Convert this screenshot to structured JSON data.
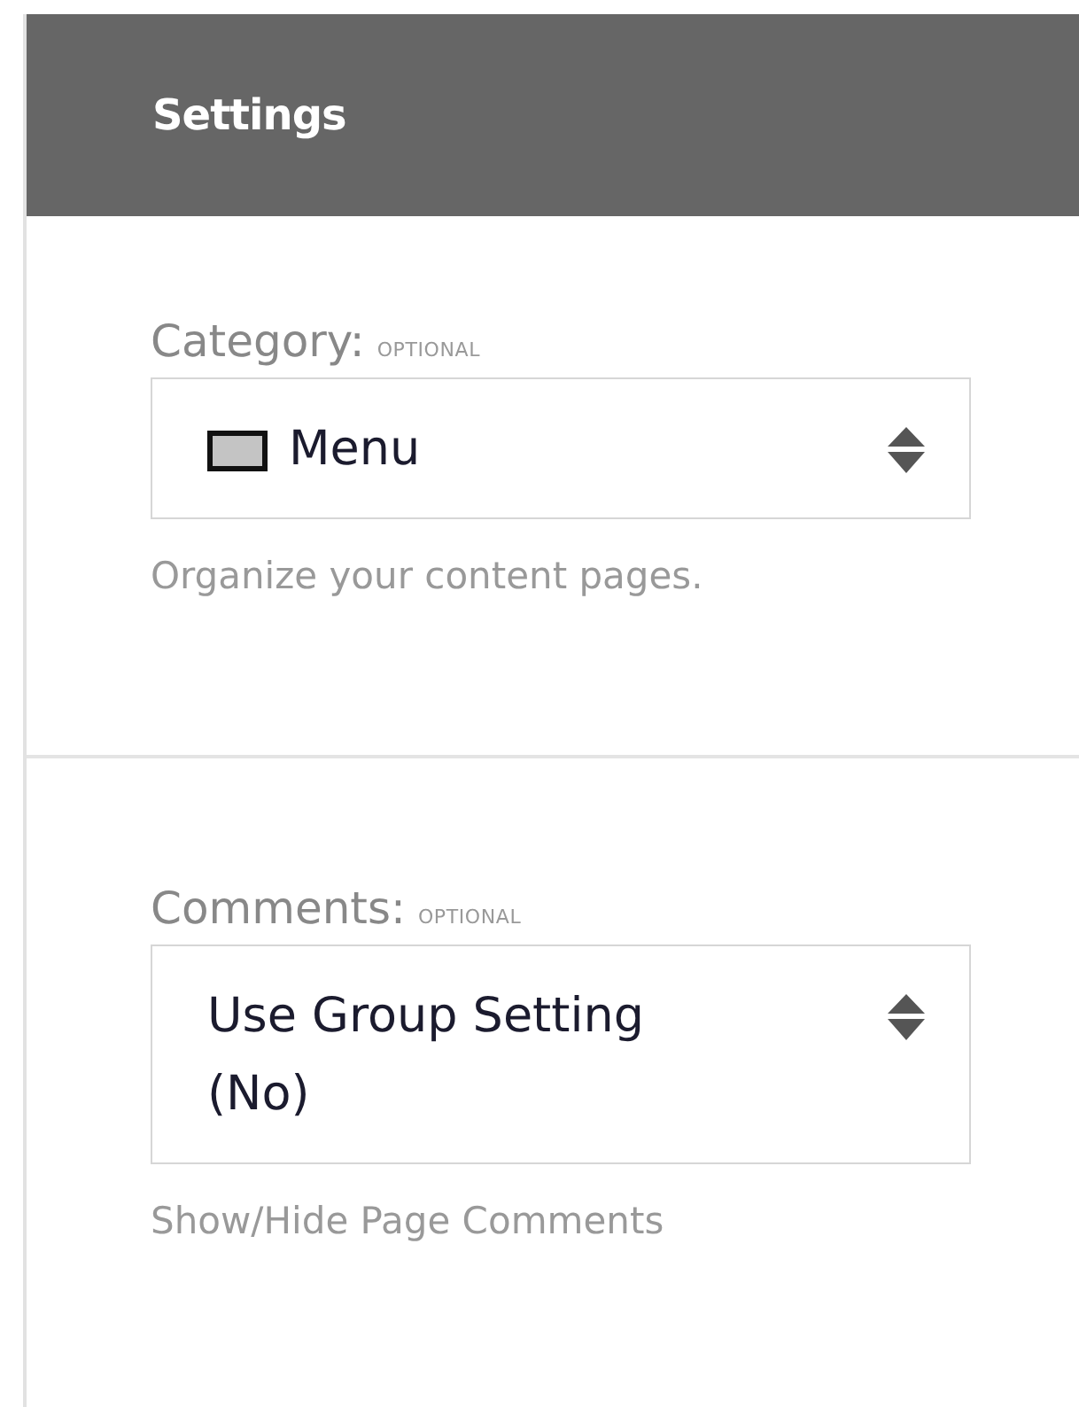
{
  "panel": {
    "title": "Settings"
  },
  "fields": [
    {
      "kind": "swatch",
      "label": "Category:",
      "tag": "OPTIONAL",
      "value": "Menu",
      "help": "Organize your content pages."
    },
    {
      "kind": "plain",
      "label": "Comments:",
      "tag": "OPTIONAL",
      "value": "Use Group Setting (No)",
      "help": "Show/Hide Page Comments"
    }
  ]
}
